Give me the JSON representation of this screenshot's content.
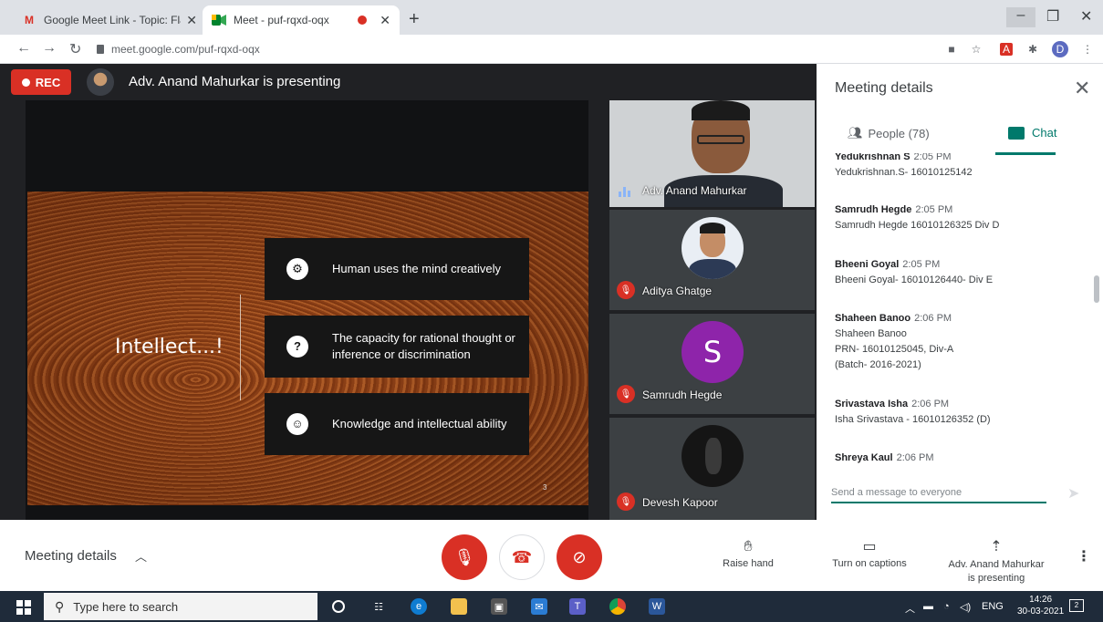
{
  "browser": {
    "tabs": [
      {
        "title": "Google Meet Link - Topic: Flavor",
        "favicon": "gmail-icon",
        "active": false
      },
      {
        "title": "Meet - puf-rqxd-oqx",
        "favicon": "meet-icon",
        "active": true
      }
    ],
    "url": "meet.google.com/puf-rqxd-oqx",
    "profile_initial": "D"
  },
  "meet": {
    "rec_label": "REC",
    "presenting_title": "Adv. Anand Mahurkar is presenting",
    "slide": {
      "heading": "Intellect...!",
      "cards": [
        {
          "icon": "mind-gear-icon",
          "text": "Human uses the mind creatively"
        },
        {
          "icon": "people-question-icon",
          "text": "The capacity for rational thought or inference or discrimination"
        },
        {
          "icon": "brain-head-icon",
          "text": "Knowledge and intellectual ability"
        }
      ],
      "page_number": "3"
    },
    "tiles": [
      {
        "name": "Adv. Anand Mahurkar",
        "type": "video",
        "muted": false
      },
      {
        "name": "Aditya Ghatge",
        "type": "photo",
        "muted": true
      },
      {
        "name": "Samrudh Hegde",
        "type": "letter",
        "letter": "S",
        "muted": true
      },
      {
        "name": "Devesh Kapoor",
        "type": "photo-dark",
        "muted": true
      }
    ]
  },
  "panel": {
    "title": "Meeting details",
    "people_tab": "People (78)",
    "chat_tab": "Chat",
    "messages": [
      {
        "sender": "Yedukrishnan S",
        "time": "2:05 PM",
        "lines": [
          "Yedukrishnan.S- 16010125142"
        ]
      },
      {
        "sender": "Samrudh Hegde",
        "time": "2:05 PM",
        "lines": [
          "Samrudh Hegde 16010126325 Div D"
        ]
      },
      {
        "sender": "Bheeni Goyal",
        "time": "2:05 PM",
        "lines": [
          "Bheeni Goyal- 16010126440- Div E"
        ]
      },
      {
        "sender": "Shaheen Banoo",
        "time": "2:06 PM",
        "lines": [
          "Shaheen Banoo",
          "PRN- 16010125045, Div-A",
          "(Batch- 2016-2021)"
        ]
      },
      {
        "sender": "Srivastava Isha",
        "time": "2:06 PM",
        "lines": [
          "Isha Srivastava - 16010126352 (D)"
        ]
      },
      {
        "sender": "Shreya Kaul",
        "time": "2:06 PM",
        "lines": []
      }
    ],
    "input_placeholder": "Send a message to everyone"
  },
  "bottom": {
    "meeting_details": "Meeting details",
    "raise_hand": "Raise hand",
    "captions": "Turn on captions",
    "presenting_line1": "Adv. Anand Mahurkar",
    "presenting_line2": "is presenting"
  },
  "taskbar": {
    "search_placeholder": "Type here to search",
    "lang": "ENG",
    "time": "14:26",
    "date": "30-03-2021",
    "notif_count": "2"
  },
  "colors": {
    "meet_red": "#d93025",
    "chat_teal": "#00796b",
    "stage_bg": "#202124",
    "taskbar_bg": "#1f2b3a"
  }
}
